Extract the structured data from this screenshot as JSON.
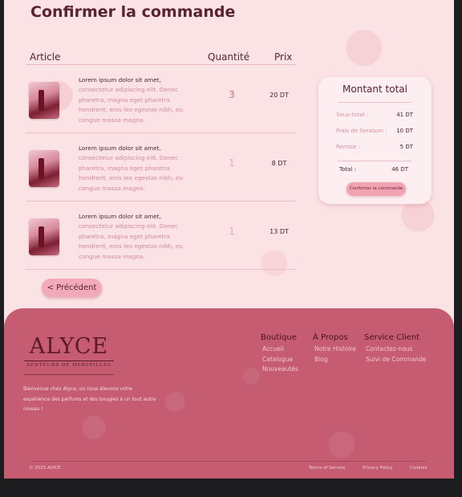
{
  "page": {
    "title": "Confirmer la commande"
  },
  "table": {
    "headers": {
      "article": "Article",
      "quantity": "Quantité",
      "price": "Prix"
    },
    "rows": [
      {
        "desc_bold": "Lorem ipsum dolor sit amet,",
        "desc_rest": "consectetur adipiscing elit. Donec pharetra, magna eget pharetra hendrerit, eros leo egestas nibh, eu congue massa magna.",
        "quantity": "3",
        "price": "20 DT"
      },
      {
        "desc_bold": "Lorem ipsum dolor sit amet,",
        "desc_rest": "consectetur adipiscing elit. Donec pharetra, magna eget pharetra hendrerit, eros leo egestas nibh, eu congue massa magna.",
        "quantity": "1",
        "price": "8 DT"
      },
      {
        "desc_bold": "Lorem ipsum dolor sit amet,",
        "desc_rest": "consectetur adipiscing elit. Donec pharetra, magna eget pharetra hendrerit, eros leo egestas nibh, eu congue massa magna.",
        "quantity": "1",
        "price": "13 DT"
      }
    ]
  },
  "back_button": {
    "label": "< Précédent"
  },
  "summary": {
    "title": "Montant total",
    "subtotal_label": "Sous-total :",
    "subtotal_value": "41 DT",
    "shipping_label": "Frais de livraison :",
    "shipping_value": "10 DT",
    "discount_label": "Remise :",
    "discount_value": "5 DT",
    "total_label": "Total :",
    "total_value": "46 DT",
    "confirm_label": "Confirmer la commande"
  },
  "footer": {
    "logo_name": "ALYCE",
    "logo_sub": "SENTEURS DE MERVEILLES",
    "about": "Bienvenue chez Alyce, où nous élevons votre expérience des parfums et des bougies à un tout autre niveau !",
    "columns": [
      {
        "title": "Boutique",
        "links": [
          "Accueil",
          "Catalogue",
          "Nouveautés"
        ]
      },
      {
        "title": "À Propos",
        "links": [
          "Notre Histoire",
          "Blog"
        ]
      },
      {
        "title": "Service Client",
        "links": [
          "Contactez-nous",
          "Suivi de Commande"
        ]
      }
    ],
    "copyright": "© 2025 ALYCE.",
    "legal": {
      "terms": "Terms of Service",
      "privacy": "Privacy Policy",
      "cookies": "Cookies"
    }
  },
  "colors": {
    "accent": "#c55c72",
    "background": "#fbe3e5",
    "button": "#f3aab8"
  }
}
